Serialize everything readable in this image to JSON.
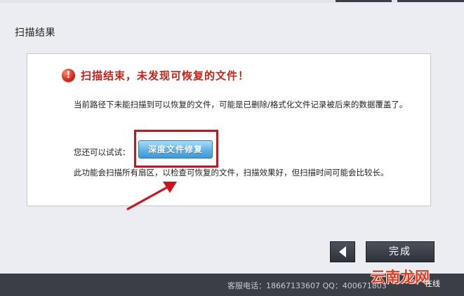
{
  "section": {
    "title": "扫描结果"
  },
  "alert": {
    "icon_glyph": "!",
    "icon": "error-exclamation-icon",
    "title": "扫描结束，未发现可恢复的文件！",
    "color": "#c4231a"
  },
  "description": "当前路径下未能扫描到可以恢复的文件，可能是已删除/格式化文件记录被后来的数据覆盖了。",
  "try_label": "您还可以试试：",
  "deep_recovery_button": {
    "label": "深度文件修复"
  },
  "sub_description": "此功能会扫描所有扇区，以检查可恢复的文件，扫描效果好，但扫描时间可能会比较长。",
  "navigation": {
    "back_icon": "left-triangle-icon",
    "done_label": "完成"
  },
  "footer": {
    "service_text": "客服电话：18667133607  QQ：400671803",
    "online_label": "在线"
  },
  "watermark": {
    "text": "云南龙网",
    "color": "#e23a1f"
  },
  "annotation": {
    "highlight_color": "#d0111b",
    "arrow_color": "#d0111b"
  }
}
